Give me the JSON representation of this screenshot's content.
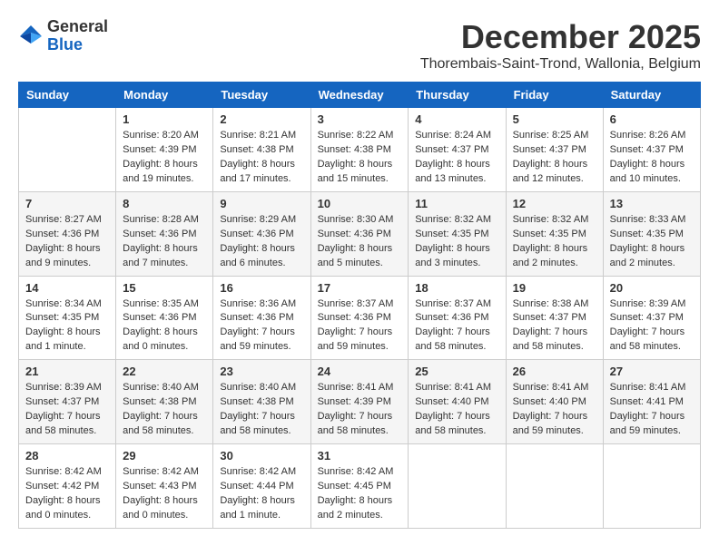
{
  "header": {
    "logo": {
      "general": "General",
      "blue": "Blue"
    },
    "title": "December 2025",
    "location": "Thorembais-Saint-Trond, Wallonia, Belgium"
  },
  "calendar": {
    "days_of_week": [
      "Sunday",
      "Monday",
      "Tuesday",
      "Wednesday",
      "Thursday",
      "Friday",
      "Saturday"
    ],
    "weeks": [
      [
        {
          "day": "",
          "info": ""
        },
        {
          "day": "1",
          "info": "Sunrise: 8:20 AM\nSunset: 4:39 PM\nDaylight: 8 hours\nand 19 minutes."
        },
        {
          "day": "2",
          "info": "Sunrise: 8:21 AM\nSunset: 4:38 PM\nDaylight: 8 hours\nand 17 minutes."
        },
        {
          "day": "3",
          "info": "Sunrise: 8:22 AM\nSunset: 4:38 PM\nDaylight: 8 hours\nand 15 minutes."
        },
        {
          "day": "4",
          "info": "Sunrise: 8:24 AM\nSunset: 4:37 PM\nDaylight: 8 hours\nand 13 minutes."
        },
        {
          "day": "5",
          "info": "Sunrise: 8:25 AM\nSunset: 4:37 PM\nDaylight: 8 hours\nand 12 minutes."
        },
        {
          "day": "6",
          "info": "Sunrise: 8:26 AM\nSunset: 4:37 PM\nDaylight: 8 hours\nand 10 minutes."
        }
      ],
      [
        {
          "day": "7",
          "info": "Sunrise: 8:27 AM\nSunset: 4:36 PM\nDaylight: 8 hours\nand 9 minutes."
        },
        {
          "day": "8",
          "info": "Sunrise: 8:28 AM\nSunset: 4:36 PM\nDaylight: 8 hours\nand 7 minutes."
        },
        {
          "day": "9",
          "info": "Sunrise: 8:29 AM\nSunset: 4:36 PM\nDaylight: 8 hours\nand 6 minutes."
        },
        {
          "day": "10",
          "info": "Sunrise: 8:30 AM\nSunset: 4:36 PM\nDaylight: 8 hours\nand 5 minutes."
        },
        {
          "day": "11",
          "info": "Sunrise: 8:32 AM\nSunset: 4:35 PM\nDaylight: 8 hours\nand 3 minutes."
        },
        {
          "day": "12",
          "info": "Sunrise: 8:32 AM\nSunset: 4:35 PM\nDaylight: 8 hours\nand 2 minutes."
        },
        {
          "day": "13",
          "info": "Sunrise: 8:33 AM\nSunset: 4:35 PM\nDaylight: 8 hours\nand 2 minutes."
        }
      ],
      [
        {
          "day": "14",
          "info": "Sunrise: 8:34 AM\nSunset: 4:35 PM\nDaylight: 8 hours\nand 1 minute."
        },
        {
          "day": "15",
          "info": "Sunrise: 8:35 AM\nSunset: 4:36 PM\nDaylight: 8 hours\nand 0 minutes."
        },
        {
          "day": "16",
          "info": "Sunrise: 8:36 AM\nSunset: 4:36 PM\nDaylight: 7 hours\nand 59 minutes."
        },
        {
          "day": "17",
          "info": "Sunrise: 8:37 AM\nSunset: 4:36 PM\nDaylight: 7 hours\nand 59 minutes."
        },
        {
          "day": "18",
          "info": "Sunrise: 8:37 AM\nSunset: 4:36 PM\nDaylight: 7 hours\nand 58 minutes."
        },
        {
          "day": "19",
          "info": "Sunrise: 8:38 AM\nSunset: 4:37 PM\nDaylight: 7 hours\nand 58 minutes."
        },
        {
          "day": "20",
          "info": "Sunrise: 8:39 AM\nSunset: 4:37 PM\nDaylight: 7 hours\nand 58 minutes."
        }
      ],
      [
        {
          "day": "21",
          "info": "Sunrise: 8:39 AM\nSunset: 4:37 PM\nDaylight: 7 hours\nand 58 minutes."
        },
        {
          "day": "22",
          "info": "Sunrise: 8:40 AM\nSunset: 4:38 PM\nDaylight: 7 hours\nand 58 minutes."
        },
        {
          "day": "23",
          "info": "Sunrise: 8:40 AM\nSunset: 4:38 PM\nDaylight: 7 hours\nand 58 minutes."
        },
        {
          "day": "24",
          "info": "Sunrise: 8:41 AM\nSunset: 4:39 PM\nDaylight: 7 hours\nand 58 minutes."
        },
        {
          "day": "25",
          "info": "Sunrise: 8:41 AM\nSunset: 4:40 PM\nDaylight: 7 hours\nand 58 minutes."
        },
        {
          "day": "26",
          "info": "Sunrise: 8:41 AM\nSunset: 4:40 PM\nDaylight: 7 hours\nand 59 minutes."
        },
        {
          "day": "27",
          "info": "Sunrise: 8:41 AM\nSunset: 4:41 PM\nDaylight: 7 hours\nand 59 minutes."
        }
      ],
      [
        {
          "day": "28",
          "info": "Sunrise: 8:42 AM\nSunset: 4:42 PM\nDaylight: 8 hours\nand 0 minutes."
        },
        {
          "day": "29",
          "info": "Sunrise: 8:42 AM\nSunset: 4:43 PM\nDaylight: 8 hours\nand 0 minutes."
        },
        {
          "day": "30",
          "info": "Sunrise: 8:42 AM\nSunset: 4:44 PM\nDaylight: 8 hours\nand 1 minute."
        },
        {
          "day": "31",
          "info": "Sunrise: 8:42 AM\nSunset: 4:45 PM\nDaylight: 8 hours\nand 2 minutes."
        },
        {
          "day": "",
          "info": ""
        },
        {
          "day": "",
          "info": ""
        },
        {
          "day": "",
          "info": ""
        }
      ]
    ]
  }
}
